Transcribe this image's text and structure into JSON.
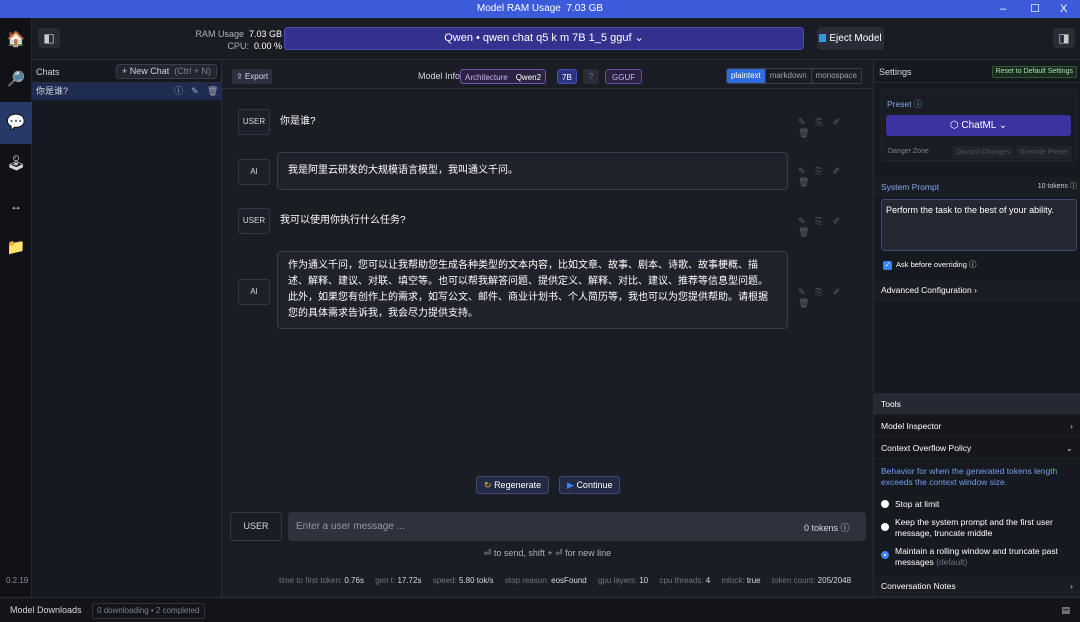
{
  "titlebar": {
    "label": "Model RAM Usage",
    "value": "7.03 GB",
    "minimize": "–",
    "maximize": "☐",
    "close": "X"
  },
  "rail": [
    {
      "icon": "home-icon",
      "glyph": "🏠"
    },
    {
      "icon": "search-icon",
      "glyph": "🔎"
    },
    {
      "icon": "chat-icon",
      "glyph": "💬"
    },
    {
      "icon": "joystick-icon",
      "glyph": "🕹"
    },
    {
      "icon": "arrows-icon",
      "glyph": "↔"
    },
    {
      "icon": "folder-icon",
      "glyph": "📁"
    }
  ],
  "header": {
    "ram_label": "RAM Usage",
    "ram_value": "7.03 GB",
    "cpu_label": "CPU:",
    "cpu_value": "0.00 %",
    "model": "Qwen • qwen chat q5 k m 7B 1_5 gguf ⌄",
    "eject": "Eject Model"
  },
  "chats": {
    "title": "Chats",
    "new_chat": "+ New Chat",
    "shortcut": "(Ctrl + N)",
    "items": [
      {
        "label": "你是谁?"
      }
    ]
  },
  "toolbar": {
    "export": "⇪ Export",
    "model_info": "Model Info",
    "arch_label": "Architecture",
    "arch_value": "Qwen2",
    "size": "7B",
    "unknown": "?",
    "format": "GGUF",
    "modes": [
      "plaintext",
      "markdown",
      "monospace"
    ]
  },
  "messages": [
    {
      "role": "USER",
      "text": "你是谁?"
    },
    {
      "role": "AI",
      "text": "我是阿里云研发的大规模语言模型，我叫通义千问。"
    },
    {
      "role": "USER",
      "text": "我可以使用你执行什么任务?"
    },
    {
      "role": "AI",
      "text": "作为通义千问，您可以让我帮助您生成各种类型的文本内容，比如文章、故事、剧本、诗歌、故事梗概、描述、解释、建议、对联、填空等。也可以帮我解答问题、提供定义、解释、对比、建议、推荐等信息型问题。此外，如果您有创作上的需求，如写公文、邮件、商业计划书、个人简历等，我也可以为您提供帮助。请根据您的具体需求告诉我，我会尽力提供支持。"
    }
  ],
  "actions": {
    "regenerate": "Regenerate",
    "continue": "Continue"
  },
  "composer": {
    "role": "USER",
    "placeholder": "Enter a user message ...",
    "tokens": "0 tokens ⓘ",
    "hint": "⏎ to send, shift + ⏎ for new line"
  },
  "stats": [
    {
      "label": "time to first token:",
      "value": "0.76s"
    },
    {
      "label": "gen t:",
      "value": "17.72s"
    },
    {
      "label": "speed:",
      "value": "5.80 tok/s"
    },
    {
      "label": "stop reason:",
      "value": "eosFound"
    },
    {
      "label": "gpu layers:",
      "value": "10"
    },
    {
      "label": "cpu threads:",
      "value": "4"
    },
    {
      "label": "mlock:",
      "value": "true"
    },
    {
      "label": "token count:",
      "value": "205/2048"
    }
  ],
  "version": "0.2.19",
  "settings": {
    "title": "Settings",
    "reset": "Reset to Default Settings",
    "preset_label": "Preset ⓘ",
    "preset": "⬡ ChatML ⌄",
    "danger_zone": "Danger Zone",
    "discard": "Discard Changes",
    "override": "Override Preset",
    "system_prompt_label": "System Prompt",
    "system_prompt_tokens": "10 tokens ⓘ",
    "system_prompt": "Perform the task to the best of your ability.",
    "ask_override": "Ask before overriding ⓘ",
    "advanced": "Advanced Configuration",
    "tools": "Tools",
    "model_inspector": "Model Inspector",
    "overflow": "Context Overflow Policy",
    "overflow_desc": "Behavior for when the generated tokens length exceeds the context window size.",
    "opt1": "Stop at limit",
    "opt2": "Keep the system prompt and the first user message, truncate middle",
    "opt3": "Maintain a rolling window and truncate past messages",
    "opt3_note": "(default)",
    "notes": "Conversation Notes"
  },
  "bottom": {
    "downloads": "Model Downloads",
    "status": "0 downloading • 2 completed"
  }
}
